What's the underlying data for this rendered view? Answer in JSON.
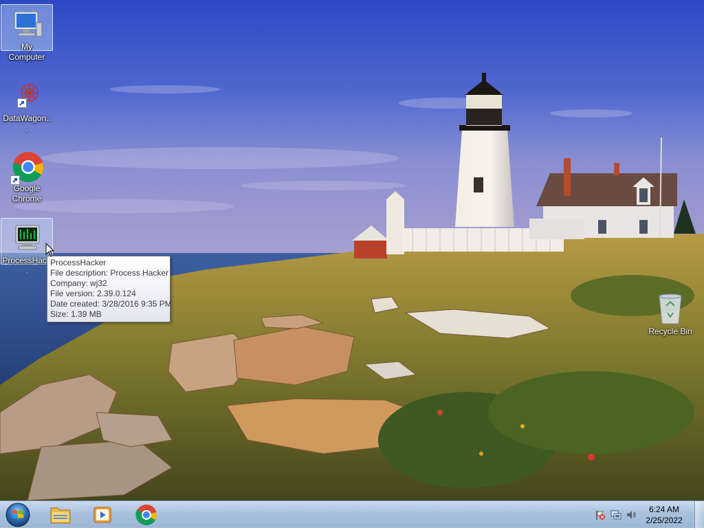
{
  "desktop": {
    "icons": [
      {
        "label": "My Computer"
      },
      {
        "label": "DataWagon..."
      },
      {
        "label": "Google Chrome"
      },
      {
        "label": "ProcessHac..."
      },
      {
        "label": "Recycle Bin"
      }
    ]
  },
  "tooltip": {
    "lines": [
      "ProcessHacker",
      "File description: Process Hacker",
      "Company: wj32",
      "File version: 2.39.0.124",
      "Date created: 3/28/2016 9:35 PM",
      "Size: 1.39 MB"
    ]
  },
  "taskbar": {
    "start_icon": "windows-start-orb-icon",
    "pinned": [
      {
        "icon": "file-explorer-icon"
      },
      {
        "icon": "media-player-icon"
      },
      {
        "icon": "google-chrome-icon"
      }
    ],
    "tray": {
      "icons": [
        "action-center-flag-icon",
        "network-icon",
        "volume-icon"
      ],
      "time": "6:24 AM",
      "date": "2/25/2022"
    }
  },
  "colors": {
    "sky_top": "#3a56c8",
    "sea": "#2b4f8f",
    "grass": "#8a7a32",
    "taskbar": "#b3c8e2"
  }
}
